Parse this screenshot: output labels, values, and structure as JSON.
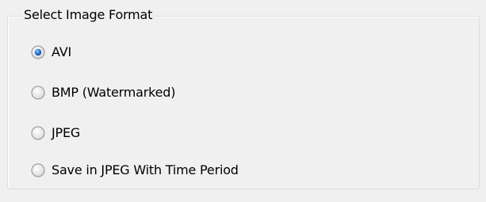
{
  "group": {
    "title": "Select Image Format"
  },
  "options": [
    {
      "label": "AVI",
      "selected": true
    },
    {
      "label": "BMP (Watermarked)",
      "selected": false
    },
    {
      "label": "JPEG",
      "selected": false
    },
    {
      "label": "Save in JPEG With Time Period",
      "selected": false
    }
  ],
  "colors": {
    "window_bg": "#f0f0f0",
    "group_border": "#d5dfe5",
    "radio_dot": "#1f5fb4"
  }
}
